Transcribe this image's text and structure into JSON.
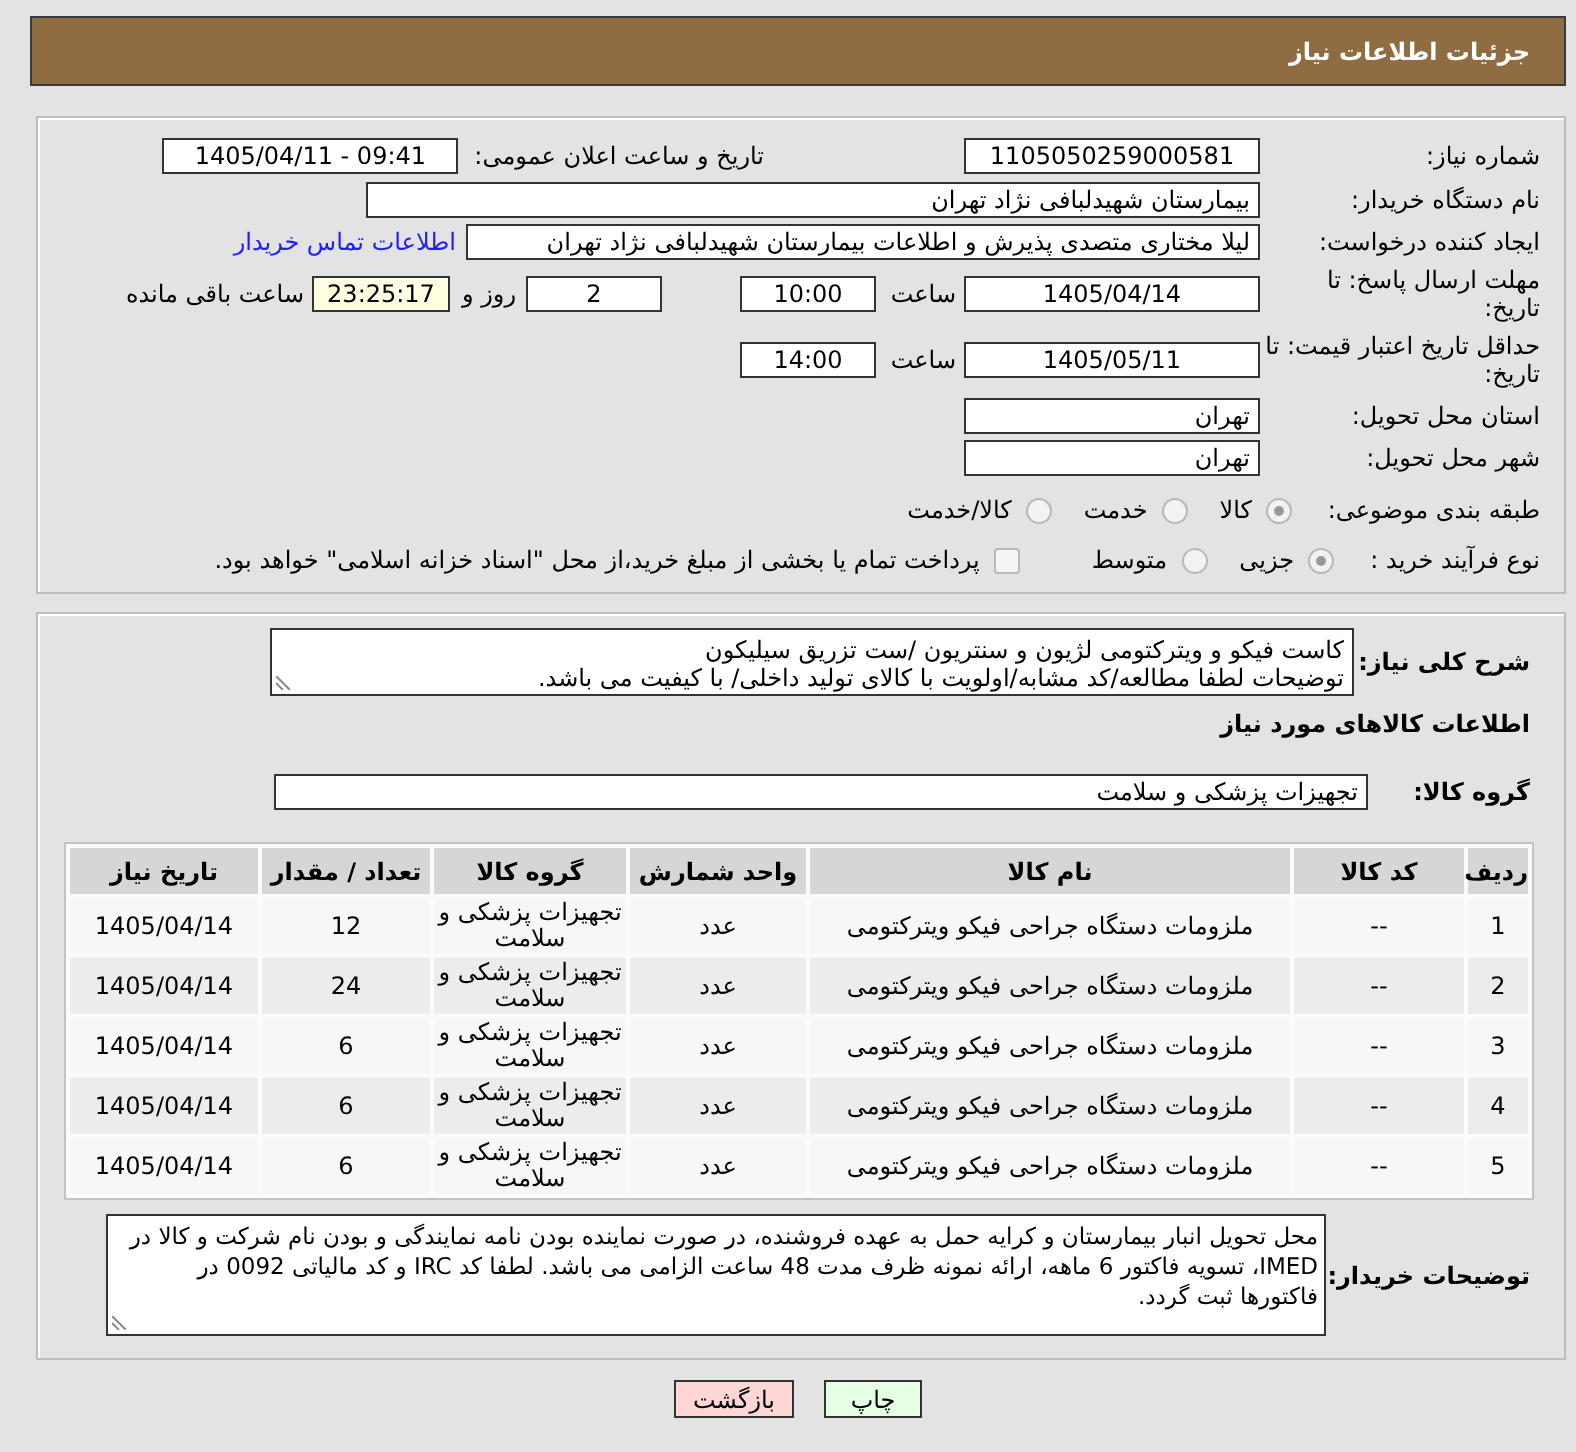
{
  "header": {
    "title": "جزئیات اطلاعات نیاز"
  },
  "form": {
    "need_number": {
      "label": "شماره نیاز:",
      "value": "1105050259000581"
    },
    "announcement": {
      "label": "تاریخ و ساعت اعلان عمومی:",
      "value": "1405/04/11 - 09:41"
    },
    "buyer_org": {
      "label": "نام دستگاه خریدار:",
      "value": "بیمارستان شهیدلبافی نژاد تهران"
    },
    "requester": {
      "label": "ایجاد کننده درخواست:",
      "value": "لیلا مختاری متصدی پذیرش و اطلاعات بیمارستان شهیدلبافی نژاد تهران",
      "link": "اطلاعات تماس خریدار"
    },
    "reply_deadline": {
      "label": "مهلت ارسال پاسخ: تا تاریخ:",
      "date": "1405/04/14",
      "time_label": "ساعت",
      "time": "10:00",
      "days": "2",
      "days_label": "روز و",
      "remaining": "23:25:17",
      "remaining_label": "ساعت باقی مانده"
    },
    "price_validity": {
      "label": "حداقل تاریخ اعتبار قیمت: تا تاریخ:",
      "date": "1405/05/11",
      "time_label": "ساعت",
      "time": "14:00"
    },
    "province": {
      "label": "استان محل تحویل:",
      "value": "تهران"
    },
    "city": {
      "label": "شهر محل تحویل:",
      "value": "تهران"
    },
    "category": {
      "label": "طبقه بندی موضوعی:",
      "options": [
        {
          "label": "کالا",
          "selected": true
        },
        {
          "label": "خدمت",
          "selected": false
        },
        {
          "label": "کالا/خدمت",
          "selected": false
        }
      ]
    },
    "purchase_type": {
      "label": "نوع فرآیند خرید :",
      "options": [
        {
          "label": "جزیی",
          "selected": true
        },
        {
          "label": "متوسط",
          "selected": false
        }
      ],
      "treasury": {
        "label": "پرداخت تمام یا بخشی از مبلغ خرید،از محل \"اسناد خزانه اسلامی\" خواهد بود.",
        "checked": false
      }
    }
  },
  "description": {
    "label": "شرح کلی نیاز:",
    "value": "کاست فیکو و ویترکتومی لژیون و سنتریون /ست تزریق سیلیکون\nتوضیحات لطفا مطالعه/کد مشابه/اولویت با کالای تولید داخلی/ با کیفیت می باشد."
  },
  "goods": {
    "title": "اطلاعات کالاهای مورد نیاز",
    "group_label": "گروه کالا:",
    "group": "تجهیزات پزشکی و سلامت",
    "table": {
      "columns": [
        "ردیف",
        "کد کالا",
        "نام کالا",
        "واحد شمارش",
        "گروه کالا",
        "تعداد / مقدار",
        "تاریخ نیاز"
      ],
      "rows": [
        [
          "1",
          "--",
          "ملزومات دستگاه جراحی فیکو ویترکتومی",
          "عدد",
          "تجهیزات پزشکی و سلامت",
          "12",
          "1405/04/14"
        ],
        [
          "2",
          "--",
          "ملزومات دستگاه جراحی فیکو ویترکتومی",
          "عدد",
          "تجهیزات پزشکی و سلامت",
          "24",
          "1405/04/14"
        ],
        [
          "3",
          "--",
          "ملزومات دستگاه جراحی فیکو ویترکتومی",
          "عدد",
          "تجهیزات پزشکی و سلامت",
          "6",
          "1405/04/14"
        ],
        [
          "4",
          "--",
          "ملزومات دستگاه جراحی فیکو ویترکتومی",
          "عدد",
          "تجهیزات پزشکی و سلامت",
          "6",
          "1405/04/14"
        ],
        [
          "5",
          "--",
          "ملزومات دستگاه جراحی فیکو ویترکتومی",
          "عدد",
          "تجهیزات پزشکی و سلامت",
          "6",
          "1405/04/14"
        ]
      ]
    }
  },
  "buyer_notes": {
    "label": "توضیحات خریدار:",
    "value": "محل تحویل انبار بیمارستان و کرایه حمل به عهده فروشنده، در صورت نماینده بودن نامه نمایندگی و بودن نام شرکت و کالا در IMED، تسویه فاکتور 6 ماهه، ارائه نمونه ظرف مدت 48 ساعت الزامی می باشد. لطفا کد IRC و کد مالیاتی 0092 در فاکتورها ثبت گردد."
  },
  "buttons": [
    {
      "label": "چاپ",
      "kind": "print"
    },
    {
      "label": "بازگشت",
      "kind": "back"
    }
  ]
}
